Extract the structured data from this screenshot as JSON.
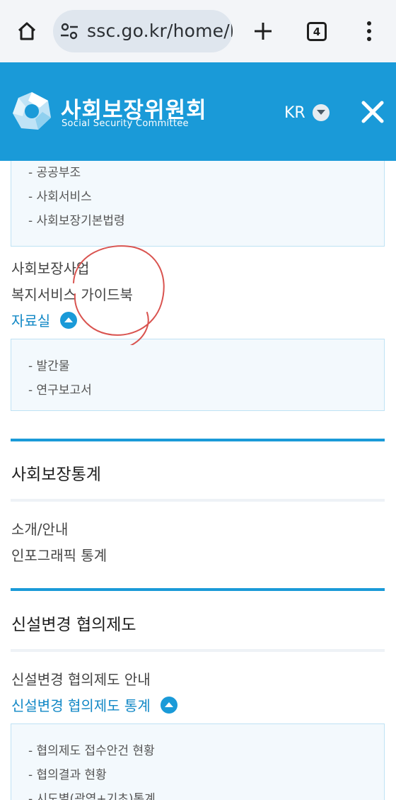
{
  "browser": {
    "url": "ssc.go.kr/home/k",
    "tab_count": "4"
  },
  "header": {
    "logo_ko": "사회보장위원회",
    "logo_en": "Social Security Committee",
    "language": "KR"
  },
  "menu": {
    "top_subitems": [
      "- 공공부조",
      "- 사회서비스",
      "- 사회보장기본법령"
    ],
    "items_1": [
      "사회보장사업",
      "복지서비스 가이드북"
    ],
    "archive_label": "자료실",
    "archive_subitems": [
      "- 발간물",
      "- 연구보고서"
    ]
  },
  "section_stats": {
    "title": "사회보장통계",
    "items": [
      "소개/안내",
      "인포그래픽 통계"
    ]
  },
  "section_consult": {
    "title": "신설변경 협의제도",
    "item_intro": "신설변경 협의제도 안내",
    "item_stats_label": "신설변경 협의제도 통계",
    "stats_subitems": [
      "- 협의제도 접수안건 현황",
      "- 협의결과 현황",
      "- 시도별(광역+기초)통계"
    ]
  },
  "colors": {
    "brand_blue": "#1a9ad8",
    "active_text": "#1288c6",
    "annotation_red": "#d9534f"
  }
}
